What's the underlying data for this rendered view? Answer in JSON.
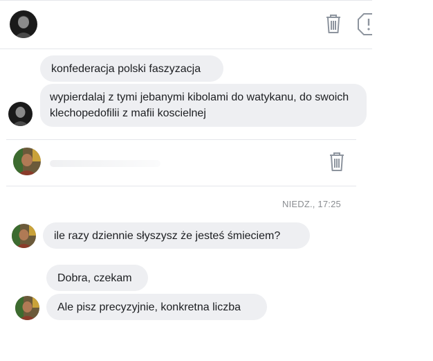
{
  "thread_one": {
    "participant_avatar": "dark-portrait-avatar",
    "delete_icon": "trash-icon",
    "report_icon": "report-exclamation-icon",
    "messages": [
      {
        "text": "konfederacja polski faszyzacja"
      },
      {
        "text": "wypierdalaj z tymi jebanymi kibolami do watykanu, do swoich klechopedofilii z mafii koscielnej"
      }
    ]
  },
  "thread_two": {
    "participant_avatar": "colorful-portrait-avatar",
    "delete_icon": "trash-icon",
    "timestamp": "NIEDZ., 17:25",
    "messages": [
      {
        "text": "ile razy dziennie słyszysz że jesteś śmieciem?"
      },
      {
        "text": "Dobra, czekam"
      },
      {
        "text": "Ale pisz precyzyjnie, konkretna liczba"
      }
    ]
  },
  "colors": {
    "bubble_bg": "#eeeff2",
    "divider": "#e4e6ea",
    "timestamp": "#8a8d91",
    "icon_gray": "#8d949e"
  }
}
